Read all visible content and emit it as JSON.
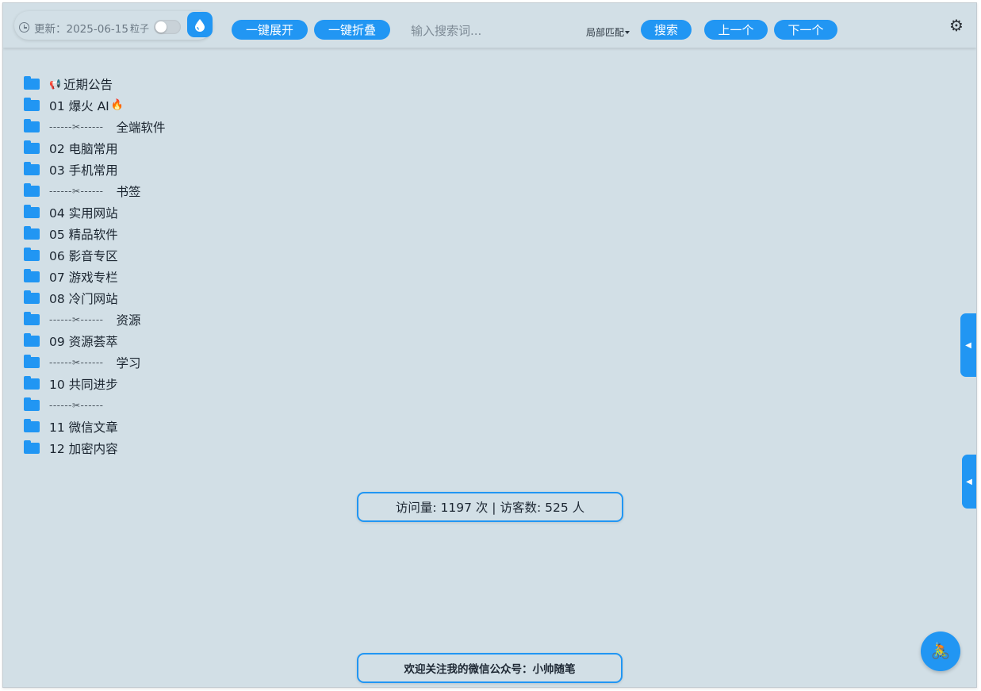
{
  "header": {
    "update_text": "更新：2025-06-15",
    "particle_label": "粒子",
    "particle_toggle_on": false,
    "expand_all": "一键展开",
    "collapse_all": "一键折叠",
    "search_placeholder": "输入搜索词...",
    "match_mode": "局部匹配",
    "search_button": "搜索",
    "prev_button": "上一个",
    "next_button": "下一个",
    "accent_color": "#2196f3",
    "background_color": "#d2dfe6",
    "icons": [
      "clock-icon",
      "water-drop-icon",
      "caret-down-icon",
      "gear-icon"
    ]
  },
  "tree": {
    "items": [
      {
        "type": "folder",
        "label": "近期公告",
        "emoji": "📢"
      },
      {
        "type": "folder",
        "label": "01 爆火 AI",
        "emoji_after": "🔥"
      },
      {
        "type": "separator",
        "dashes": "------✂------",
        "label": "全端软件"
      },
      {
        "type": "folder",
        "label": "02 电脑常用"
      },
      {
        "type": "folder",
        "label": "03 手机常用"
      },
      {
        "type": "separator",
        "dashes": "------✂------",
        "label": "书签"
      },
      {
        "type": "folder",
        "label": "04 实用网站"
      },
      {
        "type": "folder",
        "label": "05 精品软件"
      },
      {
        "type": "folder",
        "label": "06 影音专区"
      },
      {
        "type": "folder",
        "label": "07 游戏专栏"
      },
      {
        "type": "folder",
        "label": "08 冷门网站"
      },
      {
        "type": "separator",
        "dashes": "------✂------",
        "label": "资源"
      },
      {
        "type": "folder",
        "label": "09 资源荟萃"
      },
      {
        "type": "separator",
        "dashes": "------✂------",
        "label": "学习"
      },
      {
        "type": "folder",
        "label": "10 共同进步"
      },
      {
        "type": "separator",
        "dashes": "------✂------",
        "label": ""
      },
      {
        "type": "folder",
        "label": "11 微信文章"
      },
      {
        "type": "folder",
        "label": "12 加密内容"
      }
    ]
  },
  "side_tabs": {
    "upper_arrow": "◀",
    "lower_arrow": "◀"
  },
  "stats": {
    "text": "访问量: 1197 次 | 访客数: 525 人"
  },
  "footer": {
    "text": "欢迎关注我的微信公众号：小帅随笔"
  },
  "fab": {
    "icon": "🚴"
  }
}
